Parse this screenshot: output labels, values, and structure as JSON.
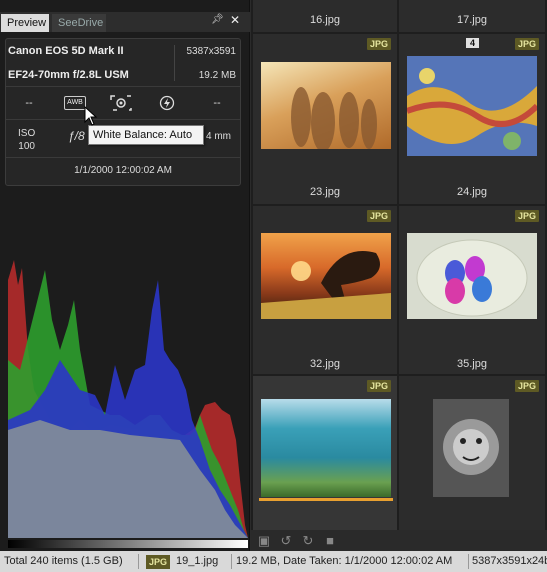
{
  "panel": {
    "tabs": [
      "Preview",
      "SeeDrive"
    ],
    "pin_icon": "pin-icon",
    "close_icon": "close-icon"
  },
  "info": {
    "camera": "Canon EOS 5D Mark II",
    "lens": "EF24-70mm f/2.8L USM",
    "resolution": "5387x3591",
    "filesize": "19.2 MB",
    "exposure_left": "--",
    "wb_label": "AWB",
    "exposure_right": "--",
    "iso_label": "ISO",
    "iso_value": "100",
    "aperture": "ƒ/8",
    "focal": "4 mm",
    "datetime": "1/1/2000 12:00:02 AM"
  },
  "tooltip": "White Balance: Auto",
  "grid": {
    "top_names": [
      "16.jpg",
      "17.jpg"
    ],
    "cells": [
      {
        "name": "23.jpg",
        "badge": "JPG",
        "rating": ""
      },
      {
        "name": "24.jpg",
        "badge": "JPG",
        "rating": "4"
      },
      {
        "name": "32.jpg",
        "badge": "JPG",
        "rating": ""
      },
      {
        "name": "35.jpg",
        "badge": "JPG",
        "rating": ""
      },
      {
        "name": "",
        "badge": "JPG",
        "rating": ""
      },
      {
        "name": "",
        "badge": "JPG",
        "rating": ""
      }
    ]
  },
  "status": {
    "total": "Total 240 items  (1.5 GB)",
    "badge": "JPG",
    "file": "19_1.jpg",
    "details": "19.2 MB, Date Taken: 1/1/2000 12:00:02 AM",
    "dims": "5387x3591x24b"
  },
  "colors": {
    "accent_badge": "#5e5a24",
    "selection": "#e8a030"
  }
}
